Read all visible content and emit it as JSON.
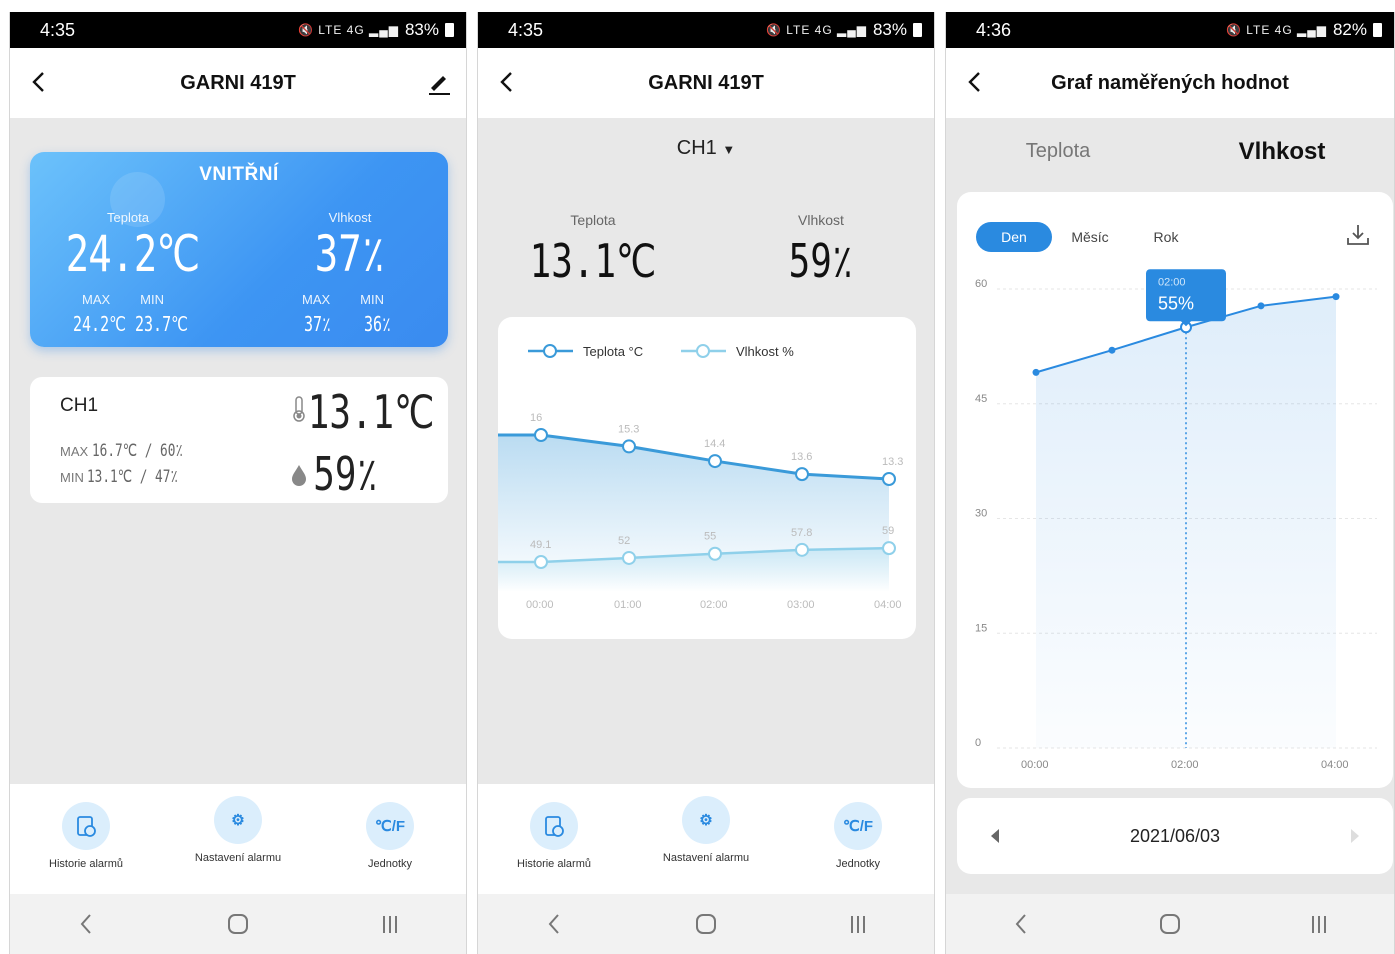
{
  "screens": [
    {
      "status": {
        "time": "4:35",
        "battery": "83%"
      },
      "title": "GARNI 419T",
      "indoor": {
        "header": "VNITŘNÍ",
        "temp_label": "Teplota",
        "temp_value": "24.2℃",
        "hum_label": "Vlhkost",
        "hum_value": "37٪",
        "max_label": "MAX",
        "min_label": "MIN",
        "temp_max": "24.2℃",
        "temp_min": "23.7℃",
        "hum_max": "37٪",
        "hum_min": "36٪"
      },
      "channel": {
        "name": "CH1",
        "max_label": "MAX",
        "max_value": "16.7℃ / 60٪",
        "min_label": "MIN",
        "min_value": "13.1℃ / 47٪",
        "temp_value": "13.1℃",
        "hum_value": "59٪"
      }
    },
    {
      "status": {
        "time": "4:35",
        "battery": "83%"
      },
      "title": "GARNI 419T",
      "channel_select": "CH1",
      "temp_label": "Teplota",
      "temp_value": "13.1℃",
      "hum_label": "Vlhkost",
      "hum_value": "59٪"
    },
    {
      "status": {
        "time": "4:36",
        "battery": "82%"
      },
      "title": "Graf naměřených hodnot",
      "tabs": [
        "Teplota",
        "Vlhkost"
      ],
      "periods": [
        "Den",
        "Měsíc",
        "Rok"
      ],
      "tooltip_time": "02:00",
      "tooltip_value": "55%",
      "date": "2021/06/03"
    }
  ],
  "bottom_bar": {
    "history": "Historie alarmů",
    "settings": "Nastavení alarmu",
    "units": "Jednotky",
    "units_icon": "℃/F"
  },
  "chart_data": [
    {
      "type": "line",
      "x": [
        "00:00",
        "01:00",
        "02:00",
        "03:00",
        "04:00"
      ],
      "series": [
        {
          "name": "Teplota °C",
          "values": [
            16,
            15.3,
            14.4,
            13.6,
            13.3
          ],
          "color": "#3a9ad9"
        },
        {
          "name": "Vlhkost %",
          "values": [
            49.1,
            52,
            55,
            57.8,
            59
          ],
          "color": "#8fd0ea"
        }
      ]
    },
    {
      "type": "area",
      "x": [
        "00:00",
        "01:00",
        "02:00",
        "03:00",
        "04:00"
      ],
      "yticks": [
        0,
        15,
        30,
        45,
        60
      ],
      "ylim": [
        0,
        60
      ],
      "series": [
        {
          "name": "Vlhkost",
          "values": [
            49.1,
            52,
            55,
            57.8,
            59
          ],
          "color": "#2a8ae0"
        }
      ],
      "highlight": {
        "x": "02:00",
        "value": 55
      }
    }
  ],
  "colors": {
    "accent": "#2a8ae0",
    "card_gradient_start": "#6cc2fb",
    "card_gradient_end": "#3a8bf0"
  }
}
